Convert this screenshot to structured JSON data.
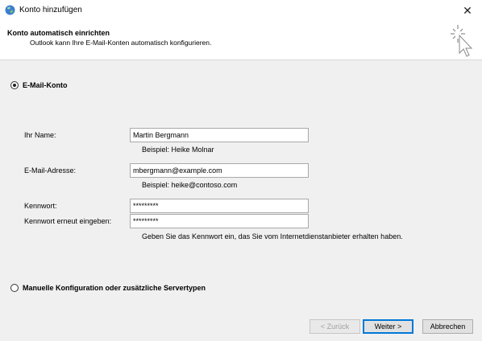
{
  "window": {
    "title": "Konto hinzufügen",
    "close_glyph": "✕"
  },
  "header": {
    "title": "Konto automatisch einrichten",
    "subtitle": "Outlook kann Ihre E-Mail-Konten automatisch konfigurieren."
  },
  "options": {
    "email_account": {
      "label": "E-Mail-Konto",
      "selected": true
    },
    "manual": {
      "label": "Manuelle Konfiguration oder zusätzliche Servertypen",
      "selected": false
    }
  },
  "form": {
    "name": {
      "label": "Ihr Name:",
      "value": "Martin Bergmann",
      "hint": "Beispiel: Heike Molnar"
    },
    "email": {
      "label": "E-Mail-Adresse:",
      "value": "mbergmann@example.com",
      "hint": "Beispiel: heike@contoso.com"
    },
    "password": {
      "label": "Kennwort:",
      "value": "*********"
    },
    "password_confirm": {
      "label": "Kennwort erneut eingeben:",
      "value": "*********"
    },
    "password_hint": "Geben Sie das Kennwort ein, das Sie vom Internetdienstanbieter erhalten haben."
  },
  "buttons": {
    "back": "< Zurück",
    "next": "Weiter >",
    "cancel": "Abbrechen"
  },
  "icons": {
    "app": "outlook-globe-icon",
    "header": "magic-wand-cursor-icon"
  },
  "colors": {
    "accent": "#0078d7",
    "dialog_bg": "#f0f0f0",
    "header_bg": "#ffffff"
  }
}
